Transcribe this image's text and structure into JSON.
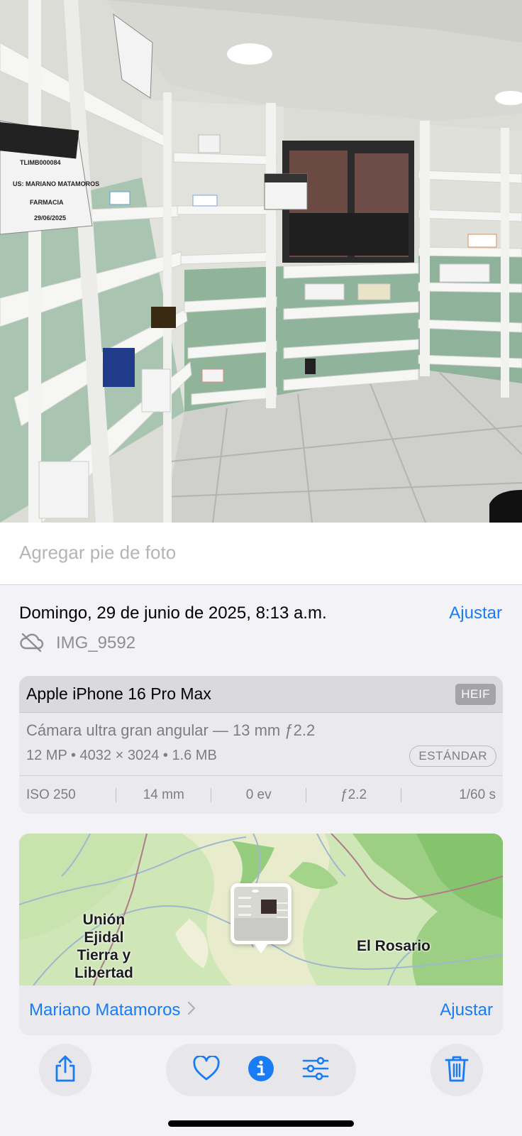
{
  "photo": {
    "alt": "",
    "sign_texts": [
      "TLIMB000084",
      "US: MARIANO MATAMOROS",
      "FARMACIA",
      "29/06/2025"
    ]
  },
  "caption": {
    "placeholder": "Agregar pie de foto",
    "value": ""
  },
  "details": {
    "date": "Domingo, 29 de junio de 2025, 8:13 a.m.",
    "adjust_label": "Ajustar",
    "filename": "IMG_9592",
    "cloud_icon": "cloud-slash-icon"
  },
  "camera": {
    "model": "Apple iPhone 16 Pro Max",
    "format_badge": "HEIF",
    "lens": "Cámara ultra gran angular — 13 mm ƒ2.2",
    "specs": "12 MP  •  4032 × 3024  •  1.6 MB",
    "style_badge": "ESTÁNDAR",
    "exif": [
      "ISO 250",
      "14 mm",
      "0 ev",
      "ƒ2.2",
      "1/60 s"
    ]
  },
  "map": {
    "labels": [
      "Unión\nEjidal\nTierra y\nLibertad",
      "El Rosario"
    ],
    "label_lines": {
      "union": [
        "Unión",
        "Ejidal",
        "Tierra y",
        "Libertad"
      ]
    },
    "place": "Mariano Matamoros",
    "adjust_label": "Ajustar"
  },
  "toolbar": {
    "share_icon": "share-icon",
    "favorite_icon": "heart-icon",
    "info_icon": "info-icon",
    "edit_icon": "sliders-icon",
    "delete_icon": "trash-icon"
  },
  "colors": {
    "accent": "#1a7cf5",
    "background": "#f2f2f7",
    "card": "#e9e9ee"
  }
}
